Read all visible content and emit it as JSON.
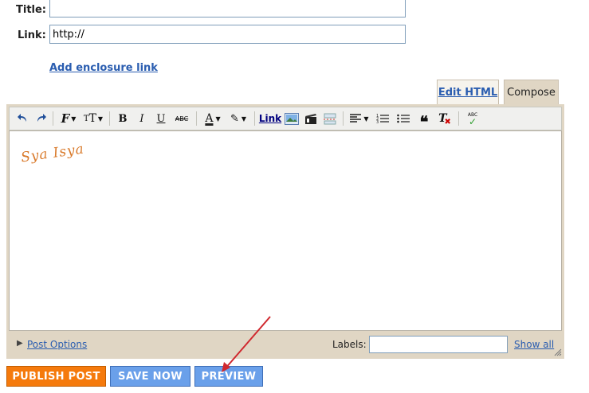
{
  "form": {
    "title_label": "Title:",
    "title_value": "",
    "link_label": "Link:",
    "link_value": "http://",
    "enclosure_link": "Add enclosure link"
  },
  "tabs": {
    "edit_html": "Edit HTML",
    "compose": "Compose"
  },
  "toolbar": {
    "link_label": "Link",
    "bold": "B",
    "italic": "I",
    "underline": "U",
    "strike": "ABC",
    "text_color": "A",
    "spell": "ABC"
  },
  "editor": {
    "content": "Sya Isya"
  },
  "post_options": {
    "label": "Post Options",
    "labels_label": "Labels:",
    "labels_value": "",
    "show_all": "Show all"
  },
  "buttons": {
    "publish": "PUBLISH POST",
    "save": "SAVE NOW",
    "preview": "PREVIEW"
  },
  "colors": {
    "publish": "#f57a0c",
    "save": "#6aa0ea",
    "frame": "#e0d6c4",
    "link": "#2a5db0",
    "signature": "#d97a2b",
    "arrow": "#d0282e"
  }
}
